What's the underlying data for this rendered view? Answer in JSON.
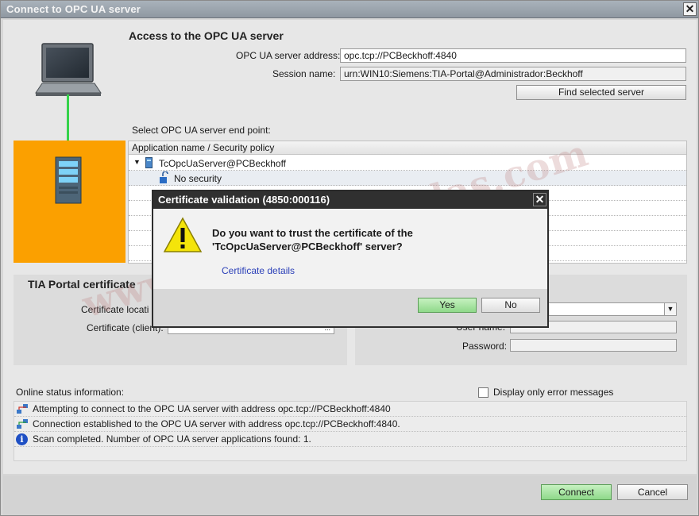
{
  "window": {
    "title": "Connect to OPC UA server"
  },
  "access": {
    "heading": "Access to the OPC UA server",
    "address_label": "OPC UA server address:",
    "address_value": "opc.tcp://PCBeckhoff:4840",
    "session_label": "Session name:",
    "session_value": "urn:WIN10:Siemens:TIA-Portal@Administrador:Beckhoff",
    "find_button": "Find selected server"
  },
  "endpoint": {
    "label": "Select OPC UA server end point:",
    "column_header": "Application name / Security policy",
    "server_name": "TcOpcUaServer@PCBeckhoff",
    "policy": "No security"
  },
  "certificate_panel": {
    "heading": "TIA Portal certificate",
    "location_label": "Certificate locati",
    "client_label": "Certificate (client):",
    "ellipsis": "..."
  },
  "auth_panel": {
    "username_label": "User name:",
    "password_label": "Password:"
  },
  "status": {
    "label": "Online status information:",
    "error_only_label": "Display only error messages",
    "messages": [
      "Attempting to connect to the OPC UA server with address opc.tcp://PCBeckhoff:4840",
      "Connection established to the OPC UA server with address opc.tcp://PCBeckhoff:4840.",
      "Scan completed. Number of OPC UA server applications found: 1."
    ]
  },
  "footer": {
    "connect": "Connect",
    "cancel": "Cancel"
  },
  "dialog": {
    "title": "Certificate validation (4850:000116)",
    "message_line1": "Do you want to trust the certificate of the",
    "message_line2": "'TcOpcUaServer@PCBeckhoff' server?",
    "details_link": "Certificate details",
    "yes": "Yes",
    "no": "No"
  },
  "watermark": "www.plc-hmi-scadas.com",
  "colors": {
    "orange": "#fba000",
    "connection_line": "#35d24a",
    "dialog_title": "#303030",
    "accent_green": "#8fd98a"
  }
}
